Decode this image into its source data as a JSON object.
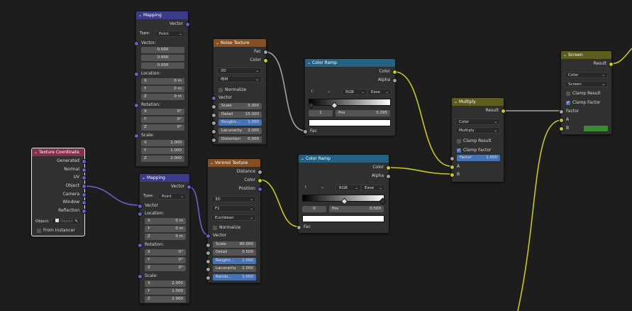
{
  "colors": {
    "header_vector": "#3b3b8a",
    "header_texture": "#864f22",
    "header_converter": "#246283",
    "header_color": "#5d5d20",
    "header_input": "#83314a",
    "link_vector": "#6363c7",
    "link_float": "#a1a1a1",
    "link_color": "#c7c729"
  },
  "mapping1": {
    "title": "Mapping",
    "out_vector": "Vector",
    "type_label": "Type:",
    "type_value": "Point",
    "vector_label": "Vector:",
    "vector_vals": [
      "0.000",
      "0.000",
      "0.000"
    ],
    "location_label": "Location:",
    "location": [
      {
        "a": "X",
        "v": "0 m"
      },
      {
        "a": "Y",
        "v": "0 m"
      },
      {
        "a": "Z",
        "v": "0 m"
      }
    ],
    "rotation_label": "Rotation:",
    "rotation": [
      {
        "a": "X",
        "v": "0°"
      },
      {
        "a": "Y",
        "v": "0°"
      },
      {
        "a": "Z",
        "v": "0°"
      }
    ],
    "scale_label": "Scale:",
    "scale": [
      {
        "a": "X",
        "v": "1.000"
      },
      {
        "a": "Y",
        "v": "1.000"
      },
      {
        "a": "Z",
        "v": "2.000"
      }
    ]
  },
  "noise": {
    "title": "Noise Texture",
    "out_fac": "Fac",
    "out_color": "Color",
    "dim": "3D",
    "basis": "fBM",
    "normalize": "Normalize",
    "in_vector": "Vector",
    "scale_l": "Scale",
    "scale_v": "5.000",
    "detail_l": "Detail",
    "detail_v": "15.000",
    "rough_l": "Roughn...",
    "rough_v": "1.000",
    "lac_l": "Lacunarity",
    "lac_v": "2.000",
    "dist_l": "Distortion",
    "dist_v": "0.000"
  },
  "ramp1": {
    "title": "Color Ramp",
    "out_color": "Color",
    "out_alpha": "Alpha",
    "icon": "I",
    "mode": "RGB",
    "interp": "Ease",
    "index": "1",
    "pos_l": "Pos",
    "pos_v": "0.295",
    "in_fac": "Fac"
  },
  "multiply": {
    "title": "Multiply",
    "out_result": "Result",
    "type": "Color",
    "blend": "Multiply",
    "clamp_result": "Clamp Result",
    "clamp_factor": "Clamp Factor",
    "factor_l": "Factor",
    "factor_v": "1.000",
    "in_a": "A",
    "in_b": "B"
  },
  "screen": {
    "title": "Screen",
    "out_result": "Result",
    "type": "Color",
    "blend": "Screen",
    "clamp_result": "Clamp Result",
    "clamp_factor": "Clamp Factor",
    "in_factor": "Factor",
    "in_a": "A",
    "in_b": "B",
    "b_color": "#3c8a34"
  },
  "texcoord": {
    "title": "Texture Coordinate",
    "outputs": [
      "Generated",
      "Normal",
      "UV",
      "Object",
      "Camera",
      "Window",
      "Reflection"
    ],
    "object_label": "Object:",
    "object_placeholder": "Object",
    "from_instancer": "From Instancer"
  },
  "mapping2": {
    "title": "Mapping",
    "out_vector": "Vector",
    "type_label": "Type:",
    "type_value": "Point",
    "in_vector": "Vector",
    "location_label": "Location:",
    "location": [
      {
        "a": "X",
        "v": "0 m"
      },
      {
        "a": "Y",
        "v": "0 m"
      },
      {
        "a": "Z",
        "v": "0 m"
      }
    ],
    "rotation_label": "Rotation:",
    "rotation": [
      {
        "a": "X",
        "v": "0°"
      },
      {
        "a": "Y",
        "v": "0°"
      },
      {
        "a": "Z",
        "v": "0°"
      }
    ],
    "scale_label": "Scale:",
    "scale": [
      {
        "a": "X",
        "v": "2.000"
      },
      {
        "a": "Y",
        "v": "1.000"
      },
      {
        "a": "Z",
        "v": "2.000"
      }
    ]
  },
  "voronoi": {
    "title": "Voronoi Texture",
    "out_distance": "Distance",
    "out_color": "Color",
    "out_position": "Position",
    "dim": "3D",
    "feature": "F1",
    "metric": "Euclidean",
    "normalize": "Normalize",
    "in_vector": "Vector",
    "scale_l": "Scale",
    "scale_v": "80.000",
    "detail_l": "Detail",
    "detail_v": "0.500",
    "rough_l": "Roughn...",
    "rough_v": "1.000",
    "lac_l": "Lacunarity",
    "lac_v": "2.000",
    "rand_l": "Rando...",
    "rand_v": "1.000"
  },
  "ramp2": {
    "title": "Color Ramp",
    "out_color": "Color",
    "out_alpha": "Alpha",
    "icon": "I",
    "mode": "RGB",
    "interp": "Ease",
    "index": "0",
    "pos_l": "Pos",
    "pos_v": "0.500",
    "in_fac": "Fac"
  }
}
